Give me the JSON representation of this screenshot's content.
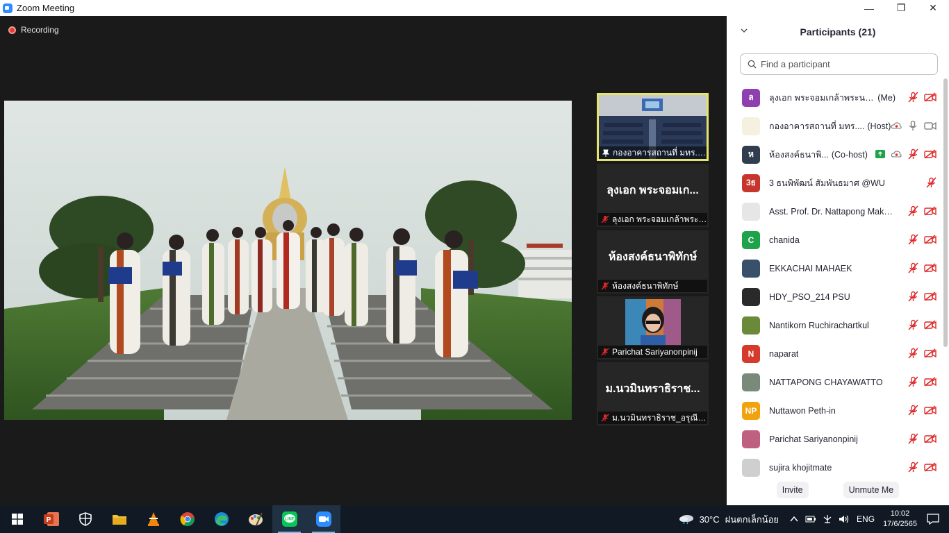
{
  "window": {
    "title": "Zoom Meeting",
    "minimize": "—",
    "maximize": "❐",
    "close": "✕"
  },
  "meeting": {
    "recording_label": "Recording",
    "tiles": [
      {
        "name": "กองอาคารสถานที่ มทร.ธั...",
        "type": "video"
      },
      {
        "big_name": "ลุงเอก พระจอมเก...",
        "caption": "ลุงเอก พระจอมเกล้าพระน..."
      },
      {
        "big_name": "ห้องสงค์ธนาพิทักษ์",
        "caption": "ห้องสงค์ธนาพิทักษ์"
      },
      {
        "caption": "Parichat Sariyanonpinij",
        "type": "video"
      },
      {
        "big_name": "ม.นวมินทราธิราช...",
        "caption": "ม.นวมินทราธิราช_อรุณี_..."
      }
    ]
  },
  "panel": {
    "title": "Participants (21)",
    "search_placeholder": "Find a participant",
    "participants": [
      {
        "name": "ลุงเอก พระจอมเกล้าพระนครเห...",
        "tag": "(Me)",
        "avatar_text": "ล",
        "avatar_color": "#8e3fb0"
      },
      {
        "name": "กองอาคารสถานที่ มทร....",
        "tag": "(Host)",
        "avatar_text": "",
        "avatar_color": "#f6f0e0"
      },
      {
        "name": "ห้องสงค์ธนาพิ...",
        "tag": "(Co-host)",
        "avatar_text": "ห",
        "avatar_color": "#2f3d4f"
      },
      {
        "name": "3 ธนพิพัฒน์ สัมพันธมาศ @WU",
        "tag": "",
        "avatar_text": "3ธ",
        "avatar_color": "#c8352d"
      },
      {
        "name": "Asst. Prof. Dr. Nattapong Maka...",
        "tag": "",
        "avatar_text": "",
        "avatar_color": "#e6e6e6"
      },
      {
        "name": "chanida",
        "tag": "",
        "avatar_text": "C",
        "avatar_color": "#1fa34a"
      },
      {
        "name": "EKKACHAI MAHAEK",
        "tag": "",
        "avatar_text": "",
        "avatar_color": "#38506a"
      },
      {
        "name": "HDY_PSO_214 PSU",
        "tag": "",
        "avatar_text": "",
        "avatar_color": "#2a2a2a"
      },
      {
        "name": "Nantikorn Ruchirachartkul",
        "tag": "",
        "avatar_text": "",
        "avatar_color": "#6a8a3a"
      },
      {
        "name": "naparat",
        "tag": "",
        "avatar_text": "N",
        "avatar_color": "#d63a2a"
      },
      {
        "name": "NATTAPONG CHAYAWATTO",
        "tag": "",
        "avatar_text": "",
        "avatar_color": "#7a8a7a"
      },
      {
        "name": "Nuttawon Peth-in",
        "tag": "",
        "avatar_text": "NP",
        "avatar_color": "#f2a20c"
      },
      {
        "name": "Parichat Sariyanonpinij",
        "tag": "",
        "avatar_text": "",
        "avatar_color": "#c06080"
      },
      {
        "name": "sujira khojitmate",
        "tag": "",
        "avatar_text": "",
        "avatar_color": "#cfcfcf"
      }
    ],
    "invite_label": "Invite",
    "unmute_label": "Unmute Me"
  },
  "taskbar": {
    "apps": [
      "start-icon",
      "powerpoint-icon",
      "security-icon",
      "file-explorer-icon",
      "vlc-icon",
      "chrome-icon",
      "edge-icon",
      "paint-icon",
      "line-icon",
      "zoom-icon"
    ],
    "weather_temp": "30°C",
    "weather_text": "ฝนตกเล็กน้อย",
    "language": "ENG",
    "time": "10:02",
    "date": "17/6/2565"
  }
}
